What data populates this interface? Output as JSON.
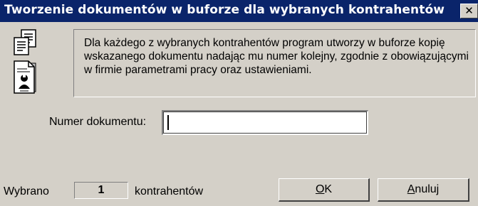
{
  "window": {
    "title": "Tworzenie dokumentów w buforze dla wybranych kontrahentów",
    "close_glyph": "✕",
    "titlebar_color": "#0a246a",
    "face_color": "#d4d0c8"
  },
  "icons": {
    "top": "copy-documents-icon",
    "bottom": "document-person-icon"
  },
  "info": {
    "text": "Dla każdego z wybranych kontrahentów program utworzy w buforze kopię wskazanego dokumentu nadając mu numer kolejny, zgodnie z obowiązującymi w firmie parametrami pracy oraz ustawieniami."
  },
  "form": {
    "number_label": "Numer dokumentu:",
    "number_value": ""
  },
  "footer": {
    "selected_label": "Wybrano",
    "selected_count": "1",
    "selected_suffix": "kontrahentów",
    "ok_first": "O",
    "ok_rest": "K",
    "cancel_first": "A",
    "cancel_rest": "nuluj"
  }
}
